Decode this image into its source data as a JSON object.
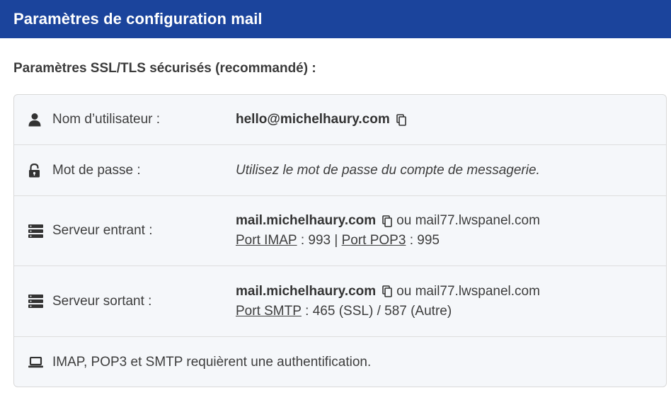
{
  "header": {
    "title": "Paramètres de configuration mail"
  },
  "section": {
    "title": "Paramètres SSL/TLS sécurisés (recommandé) :"
  },
  "rows": {
    "username": {
      "label": "Nom d’utilisateur :",
      "value": "hello@michelhaury.com",
      "icon": "user-icon"
    },
    "password": {
      "label": "Mot de passe :",
      "value": "Utilisez le mot de passe du compte de messagerie.",
      "icon": "lock-icon"
    },
    "incoming": {
      "label": "Serveur entrant :",
      "host": "mail.michelhaury.com",
      "alt_text": "ou mail77.lwspanel.com",
      "imap_link": "Port IMAP",
      "imap_value": " : 993 | ",
      "pop3_link": "Port POP3",
      "pop3_value": " : 995",
      "icon": "server-icon"
    },
    "outgoing": {
      "label": "Serveur sortant :",
      "host": "mail.michelhaury.com",
      "alt_text": "ou mail77.lwspanel.com",
      "smtp_link": "Port SMTP",
      "smtp_value": " : 465 (SSL) / 587 (Autre)",
      "icon": "server-icon"
    },
    "auth": {
      "label": "IMAP, POP3 et SMTP requièrent une authentification.",
      "icon": "laptop-icon"
    }
  },
  "colors": {
    "header_bg": "#1b449c",
    "panel_bg": "#f5f7fa",
    "text": "#3d3d3d"
  }
}
